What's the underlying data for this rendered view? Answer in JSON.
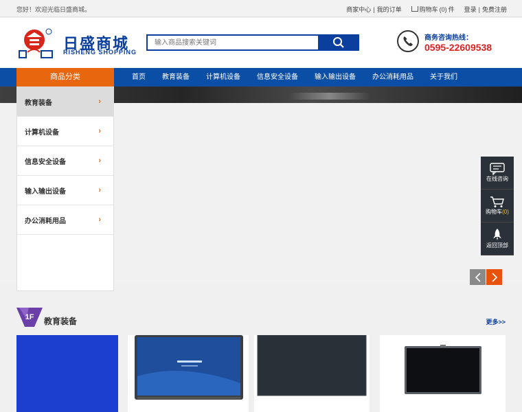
{
  "topbar": {
    "welcome": "您好！欢迎光临日盛商城。",
    "merchant_center": "商家中心",
    "my_orders": "我的订单",
    "cart_label": "购物车",
    "cart_count": "(0)",
    "cart_unit": "件",
    "login": "登录",
    "register": "免费注册",
    "sep": "|"
  },
  "header": {
    "logo_cn": "日盛商城",
    "logo_en": "RISHENG SHOPPING",
    "search_placeholder": "输入商品搜索关键词",
    "hotline_label": "商务咨询热线：",
    "hotline_number": "0595-22609538"
  },
  "nav": {
    "category_label": "商品分类",
    "items": [
      {
        "label": "首页"
      },
      {
        "label": "教育装备"
      },
      {
        "label": "计算机设备"
      },
      {
        "label": "信息安全设备"
      },
      {
        "label": "输入输出设备"
      },
      {
        "label": "办公消耗用品"
      },
      {
        "label": "关于我们"
      }
    ]
  },
  "categories": [
    {
      "label": "教育装备"
    },
    {
      "label": "计算机设备"
    },
    {
      "label": "信息安全设备"
    },
    {
      "label": "输入输出设备"
    },
    {
      "label": "办公消耗用品"
    }
  ],
  "floating": {
    "online": "在线咨询",
    "cart": "购物车",
    "cart_count": "(0)",
    "top": "返回顶部"
  },
  "floor": {
    "badge": "1F",
    "title": "教育装备",
    "more": "更多>>"
  },
  "colors": {
    "primary_blue": "#0b4ea6",
    "accent_orange": "#e8660e",
    "hotline_red": "#e02020"
  },
  "icons": {
    "search": "search-icon",
    "phone": "phone-icon",
    "chat": "chat-icon",
    "cart": "cart-icon",
    "rocket": "rocket-icon"
  }
}
